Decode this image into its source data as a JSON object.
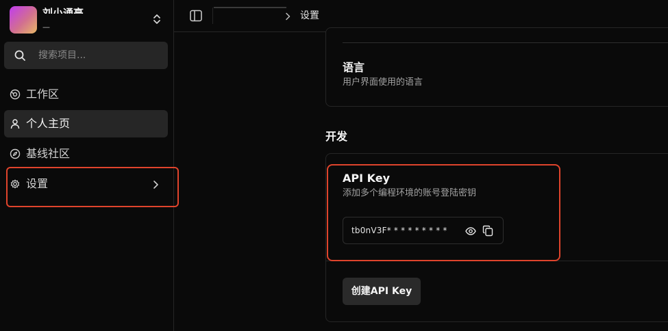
{
  "sidebar": {
    "workspace": {
      "name": "刘小通亮",
      "subtitle": "—"
    },
    "search": {
      "placeholder": "搜索项目..."
    },
    "items": [
      {
        "label": "工作区",
        "icon": "workspace-icon"
      },
      {
        "label": "个人主页",
        "icon": "user-icon",
        "active": true
      },
      {
        "label": "基线社区",
        "icon": "compass-icon"
      },
      {
        "label": "设置",
        "icon": "gear-icon"
      }
    ]
  },
  "header": {
    "breadcrumb_current": "设置"
  },
  "main": {
    "language": {
      "title": "语言",
      "description": "用户界面使用的语言"
    },
    "dev_heading": "开发",
    "api_key": {
      "title": "API Key",
      "description": "添加多个编程环境的账号登陆密钥",
      "value": "tb0nV3F* * * * * * * * *",
      "create_label": "创建API Key"
    }
  },
  "colors": {
    "highlight": "#e0442c",
    "background": "#0a0a0a",
    "surface": "#262626"
  }
}
